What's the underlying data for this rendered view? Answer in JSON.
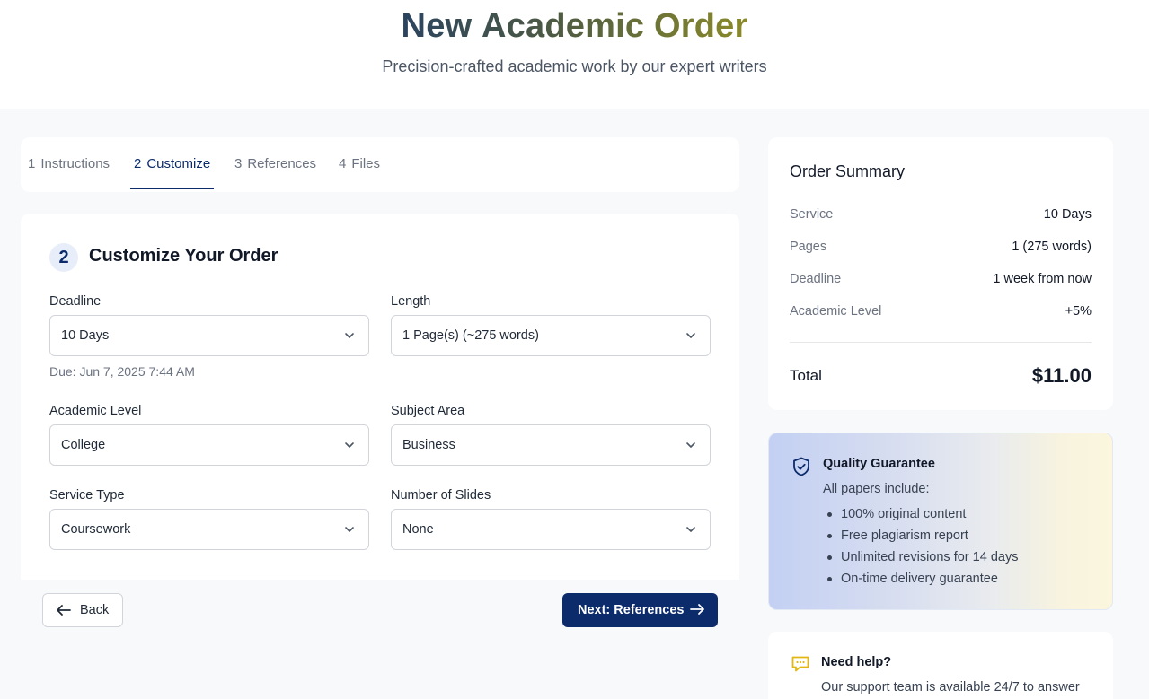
{
  "header": {
    "title_words": [
      "New",
      "Academic",
      "Order"
    ],
    "subtitle": "Precision-crafted academic work by our expert writers"
  },
  "tabs": [
    {
      "num": "1",
      "label": "Instructions",
      "active": false
    },
    {
      "num": "2",
      "label": "Customize",
      "active": true
    },
    {
      "num": "3",
      "label": "References",
      "active": false
    },
    {
      "num": "4",
      "label": "Files",
      "active": false
    }
  ],
  "form": {
    "step_number": "2",
    "title": "Customize Your Order",
    "deadline": {
      "label": "Deadline",
      "value": "10 Days"
    },
    "due_text": "Due: Jun 7, 2025 7:44 AM",
    "length": {
      "label": "Length",
      "value": "1 Page(s) (~275 words)"
    },
    "academic_level": {
      "label": "Academic Level",
      "value": "College"
    },
    "subject_area": {
      "label": "Subject Area",
      "value": "Business"
    },
    "service_type": {
      "label": "Service Type",
      "value": "Coursework"
    },
    "slides": {
      "label": "Number of Slides",
      "value": "None"
    }
  },
  "nav": {
    "back_label": "Back",
    "next_label": "Next: References"
  },
  "summary": {
    "title": "Order Summary",
    "rows": [
      {
        "key": "Service",
        "value": "10 Days"
      },
      {
        "key": "Pages",
        "value": "1 (275 words)"
      },
      {
        "key": "Deadline",
        "value": "1 week from now"
      },
      {
        "key": "Academic Level",
        "value": "+5%"
      }
    ],
    "total_label": "Total",
    "total_value": "$11.00"
  },
  "guarantee": {
    "title": "Quality Guarantee",
    "subtitle": "All papers include:",
    "items": [
      "100% original content",
      "Free plagiarism report",
      "Unlimited revisions for 14 days",
      "On-time delivery guarantee"
    ]
  },
  "help": {
    "title": "Need help?",
    "text": "Our support team is available 24/7 to answer"
  },
  "colors": {
    "primary": "#0b2b6b",
    "accent_gold": "#e0bb1a",
    "chat_icon": "#e2b714"
  },
  "icons": {
    "select_chevron": "chevron-down-icon",
    "back_arrow": "arrow-left-icon",
    "next_arrow": "arrow-right-icon",
    "guarantee": "shield-check-icon",
    "help": "chat-bubble-icon"
  }
}
